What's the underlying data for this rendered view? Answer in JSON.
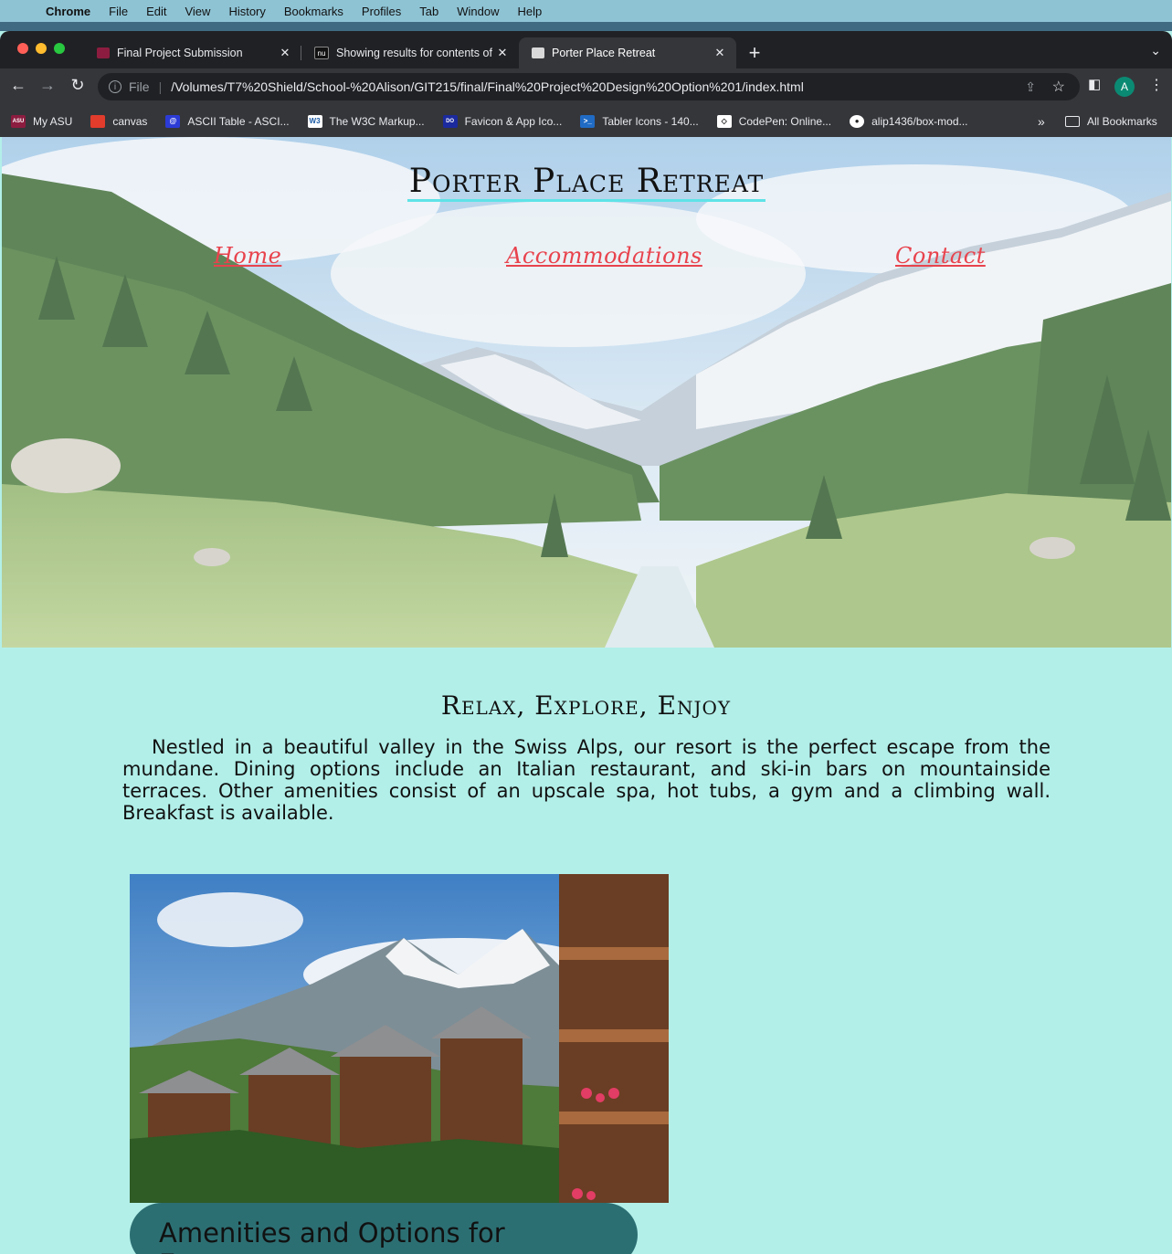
{
  "os_menu": {
    "app": "Chrome",
    "items": [
      "File",
      "Edit",
      "View",
      "History",
      "Bookmarks",
      "Profiles",
      "Tab",
      "Window",
      "Help"
    ]
  },
  "tabs": [
    {
      "title": "Final Project Submission",
      "active": false
    },
    {
      "title": "Showing results for contents of",
      "active": false
    },
    {
      "title": "Porter Place Retreat",
      "active": true
    }
  ],
  "omnibox": {
    "scheme": "File",
    "url": "/Volumes/T7%20Shield/School-%20Alison/GIT215/final/Final%20Project%20Design%20Option%201/index.html"
  },
  "profile_initial": "A",
  "bookmarks": [
    {
      "label": "My ASU",
      "icon": "asu-icon",
      "color": "#8c1d40",
      "glyph": "ASU"
    },
    {
      "label": "canvas",
      "icon": "canvas-icon",
      "color": "#e13c2c",
      "glyph": ""
    },
    {
      "label": "ASCII Table - ASCI...",
      "icon": "ascii-icon",
      "color": "#2b3bd6",
      "glyph": "@"
    },
    {
      "label": "The W3C Markup...",
      "icon": "w3c-icon",
      "color": "#1a5aa5",
      "glyph": "W3"
    },
    {
      "label": "Favicon & App Ico...",
      "icon": "favicon-icon",
      "color": "#1b2a9e",
      "glyph": "DO"
    },
    {
      "label": "Tabler Icons - 140...",
      "icon": "tabler-icon",
      "color": "#206bc4",
      "glyph": ">_"
    },
    {
      "label": "CodePen: Online...",
      "icon": "codepen-icon",
      "color": "#222222",
      "glyph": "◇"
    },
    {
      "label": "alip1436/box-mod...",
      "icon": "github-icon",
      "color": "#222222",
      "glyph": "●"
    }
  ],
  "bookmarks_all": "All Bookmarks",
  "site": {
    "title": "Porter Place Retreat",
    "nav": [
      "Home",
      "Accommodations",
      "Contact"
    ],
    "heading": "Relax, Explore, Enjoy",
    "intro": "Nestled in a beautiful valley in the Swiss Alps, our resort is the perfect escape from the mundane. Dining options include an Italian restaurant, and ski-in bars on mountainside terraces. Other amenities consist of an upscale spa, hot tubs, a gym and a climbing wall. Breakfast is available.",
    "caption": "Amenities and Options for Everyone"
  },
  "colors": {
    "page_bg": "#b2efe9",
    "nav_link": "#e8434d",
    "title_underline": "#5fe3e7",
    "caption_bg": "#2c6f73"
  }
}
